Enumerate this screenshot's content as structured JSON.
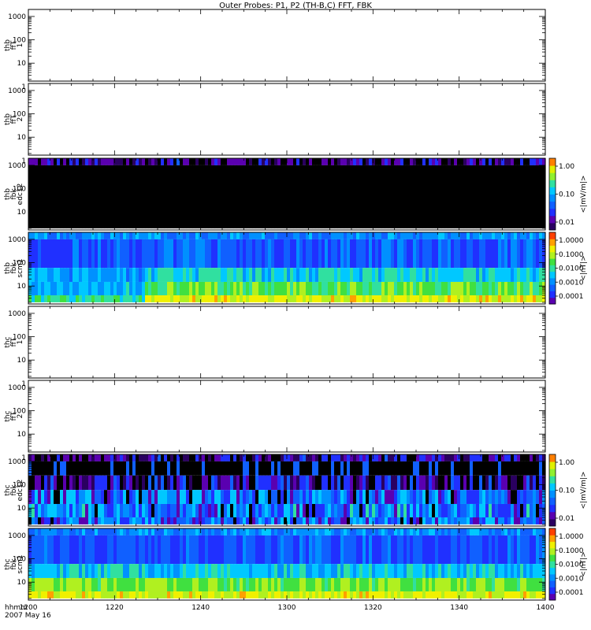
{
  "title": "Outer Probes: P1, P2 (TH-B,C) FFT, FBK",
  "time_axis": {
    "label_line1": "hhmm",
    "label_line2": "2007 May 16",
    "ticks": [
      "1200",
      "1220",
      "1240",
      "1300",
      "1320",
      "1340",
      "1400"
    ]
  },
  "colorbars": {
    "efield": {
      "label": "<|mV/m|>",
      "ticks": [
        "1.00",
        "0.10",
        "0.01"
      ]
    },
    "bfield": {
      "label": "<|nT|>",
      "ticks": [
        "1.0000",
        "0.1000",
        "0.0100",
        "0.0010",
        "0.0001"
      ]
    }
  },
  "colors": {
    "panel_blue": "#2030ff",
    "cyan": "#00c8ff",
    "green": "#30e030",
    "yellow": "#f0f000",
    "orange": "#ff8000",
    "black": "#000000"
  },
  "chart_data": [
    {
      "type": "heatmap",
      "panel": "thb ffT 1",
      "ylabel": [
        "thb",
        "ffT",
        "1"
      ],
      "yticks": [
        "1000",
        "100",
        "10",
        "1"
      ],
      "ylim": [
        1,
        1000
      ],
      "yscale": "log",
      "data": "none"
    },
    {
      "type": "heatmap",
      "panel": "thb ffT 2",
      "ylabel": [
        "thb",
        "ffT",
        "2"
      ],
      "yticks": [
        "1000",
        "100",
        "10",
        "1"
      ],
      "ylim": [
        1,
        1000
      ],
      "yscale": "log",
      "data": "none"
    },
    {
      "type": "heatmap",
      "panel": "thb fbk edc12",
      "ylabel": [
        "thb",
        "fbk",
        "edc12"
      ],
      "yticks": [
        "1000",
        "100",
        "10"
      ],
      "yscale": "log",
      "colorbar": "efield",
      "bands": [
        {
          "freq_hz_min": 1000,
          "freq_hz_max": 2000,
          "value": 0.01
        },
        {
          "freq_hz_min": 2,
          "freq_hz_max": 1000,
          "value": "below range"
        }
      ]
    },
    {
      "type": "heatmap",
      "panel": "thb fbk scm1",
      "ylabel": [
        "thb",
        "fbk",
        "scm1"
      ],
      "yticks": [
        "1000",
        "100",
        "10"
      ],
      "yscale": "log",
      "colorbar": "bfield",
      "bands": [
        {
          "freq_hz_min": 1000,
          "freq_hz_max": 2000,
          "before_1245": 0.001,
          "after_1245": 0.001
        },
        {
          "freq_hz_min": 60,
          "freq_hz_max": 1000,
          "before_1245": 0.0003,
          "after_1245": 0.0004
        },
        {
          "freq_hz_min": 15,
          "freq_hz_max": 60,
          "before_1245": 0.0015,
          "after_1245": 0.004
        },
        {
          "freq_hz_min": 4,
          "freq_hz_max": 15,
          "before_1245": 0.002,
          "after_1245": 0.02
        },
        {
          "freq_hz_min": 2,
          "freq_hz_max": 4,
          "before_1245": 0.01,
          "after_1245": 0.1
        }
      ]
    },
    {
      "type": "heatmap",
      "panel": "thc ffT 1",
      "ylabel": [
        "thc",
        "ffT",
        "1"
      ],
      "yticks": [
        "1000",
        "100",
        "10",
        "1"
      ],
      "ylim": [
        1,
        1000
      ],
      "yscale": "log",
      "data": "none"
    },
    {
      "type": "heatmap",
      "panel": "thc ffT 2",
      "ylabel": [
        "thc",
        "ffT",
        "2"
      ],
      "yticks": [
        "1000",
        "100",
        "10",
        "1"
      ],
      "ylim": [
        1,
        1000
      ],
      "yscale": "log",
      "data": "none"
    },
    {
      "type": "heatmap",
      "panel": "thc fbk edc12",
      "ylabel": [
        "thc",
        "fbk",
        "edc12"
      ],
      "yticks": [
        "1000",
        "100",
        "10"
      ],
      "yscale": "log",
      "colorbar": "efield",
      "bands": [
        {
          "freq_hz_min": 1000,
          "freq_hz_max": 2000,
          "value": 0.01
        },
        {
          "freq_hz_min": 250,
          "freq_hz_max": 1000,
          "value": "mostly below range"
        },
        {
          "freq_hz_min": 60,
          "freq_hz_max": 250,
          "value": 0.015
        },
        {
          "freq_hz_min": 15,
          "freq_hz_max": 60,
          "value": 0.05
        },
        {
          "freq_hz_min": 4,
          "freq_hz_max": 15,
          "value": 0.06
        },
        {
          "freq_hz_min": 2,
          "freq_hz_max": 4,
          "value": 0.05
        }
      ]
    },
    {
      "type": "heatmap",
      "panel": "thc fbk scm1",
      "ylabel": [
        "thc",
        "fbk",
        "scm1"
      ],
      "yticks": [
        "1000",
        "100",
        "10"
      ],
      "yscale": "log",
      "colorbar": "bfield",
      "bands": [
        {
          "freq_hz_min": 1000,
          "freq_hz_max": 2000,
          "value": 0.001
        },
        {
          "freq_hz_min": 60,
          "freq_hz_max": 1000,
          "value": 0.0003
        },
        {
          "freq_hz_min": 15,
          "freq_hz_max": 60,
          "value": 0.003
        },
        {
          "freq_hz_min": 4,
          "freq_hz_max": 15,
          "value": 0.03
        },
        {
          "freq_hz_min": 2,
          "freq_hz_max": 4,
          "value": 0.1
        }
      ]
    }
  ]
}
